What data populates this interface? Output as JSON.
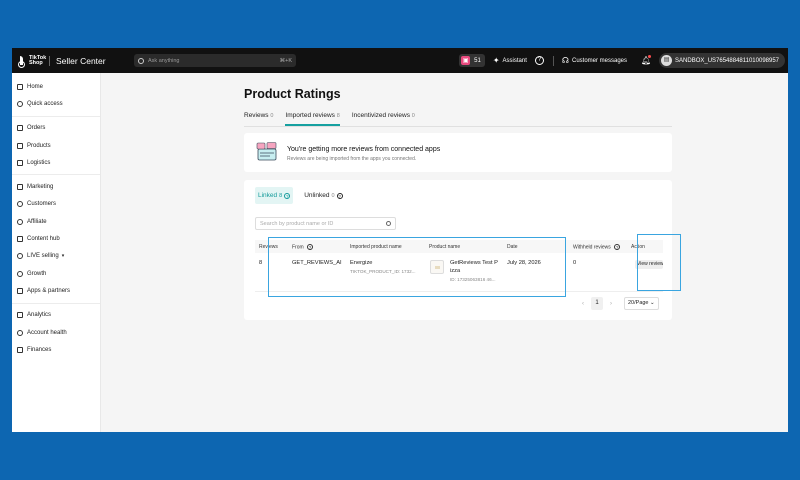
{
  "topbar": {
    "logo_text": "TikTok Shop",
    "brand": "Seller Center",
    "search_placeholder": "Ask anything",
    "search_shortcut": "⌘+K",
    "coins": "51",
    "assistant": "Assistant",
    "customer_messages": "Customer messages",
    "account": "SANDBOX_US7654884811010098957"
  },
  "sidebar": {
    "items": [
      {
        "label": "Home",
        "icon": "home-icon"
      },
      {
        "label": "Quick access",
        "icon": "quick-access-icon"
      },
      {
        "label": "Orders",
        "icon": "orders-icon"
      },
      {
        "label": "Products",
        "icon": "products-icon"
      },
      {
        "label": "Logistics",
        "icon": "logistics-icon"
      },
      {
        "label": "Marketing",
        "icon": "marketing-icon"
      },
      {
        "label": "Customers",
        "icon": "customers-icon"
      },
      {
        "label": "Affiliate",
        "icon": "affiliate-icon"
      },
      {
        "label": "Content hub",
        "icon": "content-hub-icon"
      },
      {
        "label": "LIVE selling",
        "icon": "live-icon"
      },
      {
        "label": "Growth",
        "icon": "growth-icon"
      },
      {
        "label": "Apps & partners",
        "icon": "apps-icon"
      },
      {
        "label": "Analytics",
        "icon": "analytics-icon"
      },
      {
        "label": "Account health",
        "icon": "account-health-icon"
      },
      {
        "label": "Finances",
        "icon": "finances-icon"
      }
    ]
  },
  "page": {
    "title": "Product Ratings",
    "tabs": [
      {
        "label": "Reviews",
        "count": "0"
      },
      {
        "label": "Imported reviews",
        "count": "8"
      },
      {
        "label": "Incentivized reviews",
        "count": "0"
      }
    ]
  },
  "banner": {
    "title": "You're getting more reviews from connected apps",
    "subtitle": "Reviews are being imported from the apps you connected."
  },
  "panel": {
    "subtabs": [
      {
        "label": "Linked",
        "count": "8"
      },
      {
        "label": "Unlinked",
        "count": "0"
      }
    ],
    "search_placeholder": "Search by product name or ID",
    "columns": {
      "reviews": "Reviews",
      "from": "From",
      "imported_name": "Imported product name",
      "product_name": "Product name",
      "date": "Date",
      "withheld": "Withheld reviews",
      "action": "Action"
    },
    "row": {
      "reviews": "8",
      "from": "GET_REVIEWS_AI",
      "imported_name": "Energize",
      "imported_id": "TIKTOK_PRODUCT_ID: 1732...",
      "product_line1": "GetReviews Test P",
      "product_line2": "izza",
      "product_id": "ID: 17325063816 46...",
      "date": "July 28, 2026",
      "withheld": "0",
      "action": "View reviews"
    },
    "pagination": {
      "page": "1",
      "page_size": "20/Page"
    }
  },
  "colors": {
    "accent": "#16a0a0",
    "highlight": "#3aa5e0",
    "background": "#0d66b1"
  }
}
